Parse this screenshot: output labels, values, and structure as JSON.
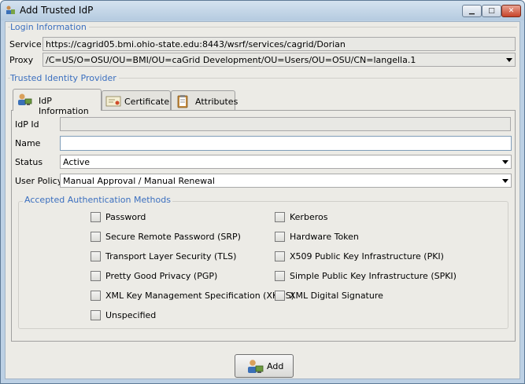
{
  "window": {
    "title": "Add Trusted IdP",
    "minimize_icon": "minimize-icon",
    "maximize_icon": "maximize-icon",
    "close_icon": "close-icon"
  },
  "login": {
    "section_title": "Login Information",
    "service_label": "Service",
    "service_value": "https://cagrid05.bmi.ohio-state.edu:8443/wsrf/services/cagrid/Dorian",
    "proxy_label": "Proxy",
    "proxy_value": "/C=US/O=OSU/OU=BMI/OU=caGrid Development/OU=Users/OU=OSU/CN=langella.1"
  },
  "idp": {
    "section_title": "Trusted Identity Provider",
    "tabs": [
      {
        "label": "IdP Information",
        "icon": "user-computer-icon"
      },
      {
        "label": "Certificate",
        "icon": "certificate-icon"
      },
      {
        "label": "Attributes",
        "icon": "clipboard-icon"
      }
    ],
    "id_label": "IdP Id",
    "id_value": "",
    "name_label": "Name",
    "name_value": "",
    "status_label": "Status",
    "status_value": "Active",
    "policy_label": "User Policy",
    "policy_value": "Manual Approval / Manual Renewal"
  },
  "auth_methods": {
    "title": "Accepted Authentication Methods",
    "left": [
      "Password",
      "Secure Remote Password (SRP)",
      "Transport Layer Security (TLS)",
      "Pretty Good Privacy (PGP)",
      "XML Key Management Specification (XKMS)",
      "Unspecified"
    ],
    "right": [
      "Kerberos",
      "Hardware Token",
      "X509 Public Key Infrastructure (PKI)",
      "Simple Public Key Infrastructure (SPKI)",
      "XML Digital Signature"
    ]
  },
  "actions": {
    "add_label": "Add",
    "add_icon": "add-user-icon"
  },
  "colors": {
    "section_title": "#3b6fbf",
    "window_frame": "#bcd0e4",
    "client_bg": "#ecebe6"
  }
}
